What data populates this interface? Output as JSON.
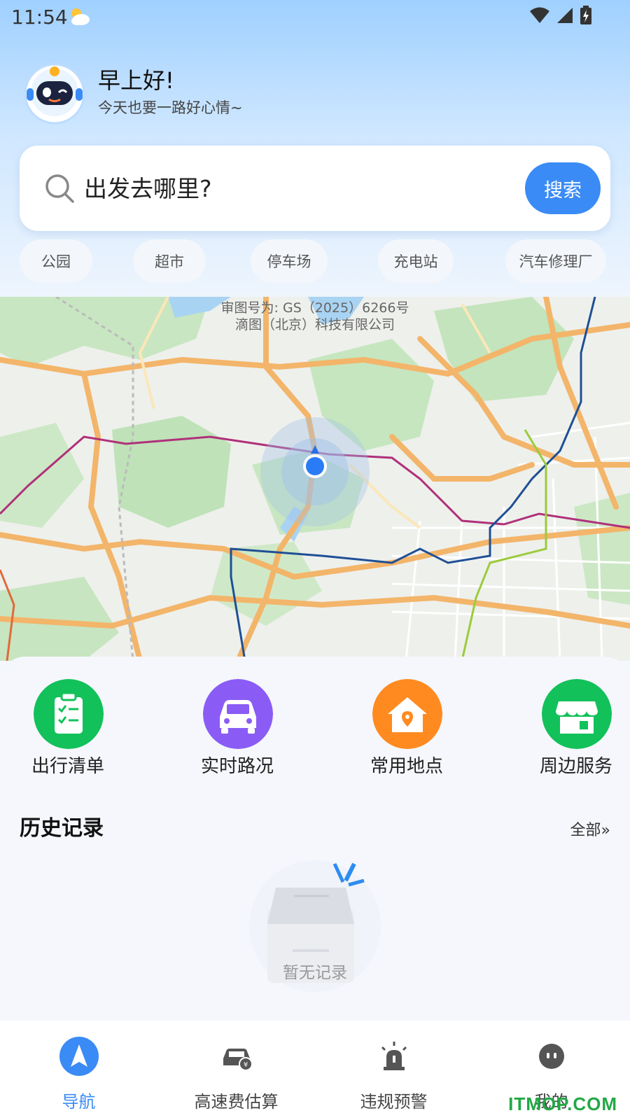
{
  "status": {
    "time": "11:54"
  },
  "greeting": {
    "title": "早上好!",
    "subtitle": "今天也要一路好心情~"
  },
  "search": {
    "placeholder": "出发去哪里?",
    "button_label": "搜索"
  },
  "quick_tags": [
    "公园",
    "超市",
    "停车场",
    "充电站",
    "汽车修理厂"
  ],
  "map": {
    "approval_line1": "审图号为: GS（2025）6266号",
    "approval_line2": "滴图（北京）科技有限公司"
  },
  "features": [
    {
      "label": "出行清单",
      "icon": "checklist-icon",
      "color": "#12c15a"
    },
    {
      "label": "实时路况",
      "icon": "car-icon",
      "color": "#8a5cf5"
    },
    {
      "label": "常用地点",
      "icon": "home-pin-icon",
      "color": "#ff8a1f"
    },
    {
      "label": "周边服务",
      "icon": "store-icon",
      "color": "#12c15a"
    }
  ],
  "history": {
    "title": "历史记录",
    "all_label": "全部»",
    "empty_text": "暂无记录"
  },
  "tabs": [
    {
      "label": "导航",
      "icon": "navigation-arrow-icon",
      "active": true
    },
    {
      "label": "高速费估算",
      "icon": "car-fee-icon",
      "active": false
    },
    {
      "label": "违规预警",
      "icon": "alarm-light-icon",
      "active": false
    },
    {
      "label": "我的",
      "icon": "profile-face-icon",
      "active": false
    }
  ],
  "watermark": "ITMOP.COM",
  "colors": {
    "accent": "#3a8bf5",
    "green": "#12c15a",
    "purple": "#8a5cf5",
    "orange": "#ff8a1f"
  }
}
